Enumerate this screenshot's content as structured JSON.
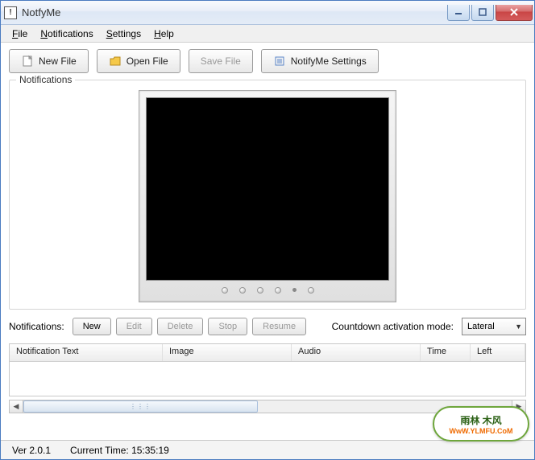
{
  "window": {
    "title": "NotfyMe"
  },
  "menu": {
    "file": "File",
    "notifications": "Notifications",
    "settings": "Settings",
    "help": "Help"
  },
  "toolbar": {
    "new_file": "New File",
    "open_file": "Open File",
    "save_file": "Save File",
    "settings": "NotifyMe Settings"
  },
  "group": {
    "label": "Notifications"
  },
  "actions": {
    "label": "Notifications:",
    "new": "New",
    "edit": "Edit",
    "delete": "Delete",
    "stop": "Stop",
    "resume": "Resume",
    "mode_label": "Countdown activation mode:",
    "mode_value": "Lateral"
  },
  "table": {
    "headers": [
      "Notification Text",
      "Image",
      "Audio",
      "Time",
      "Left"
    ]
  },
  "status": {
    "version": "Ver 2.0.1",
    "time_label": "Current Time:",
    "time_value": "15:35:19"
  },
  "watermark": {
    "cn": "雨林 木风",
    "url": "WwW.YLMFU.CoM"
  }
}
